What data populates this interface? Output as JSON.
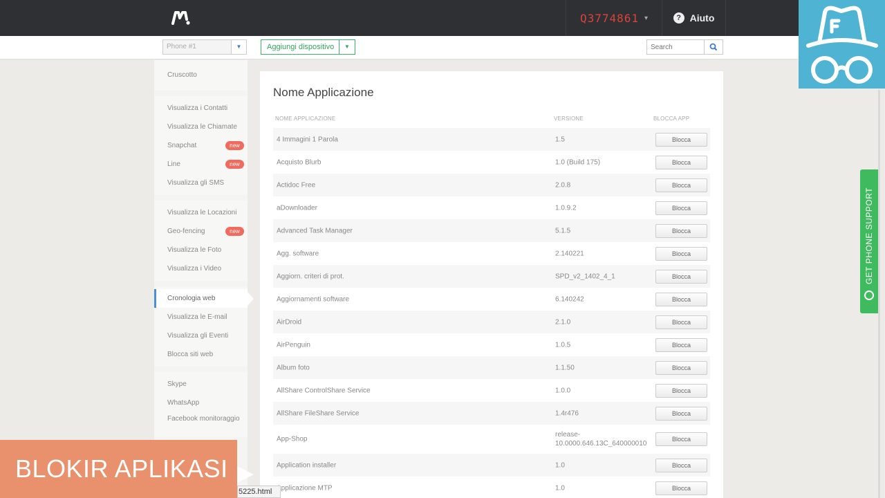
{
  "header": {
    "logo_icon": "mspy-logo-icon",
    "account_id": "Q3774861",
    "account_caret": "▾",
    "help_label": "Aiuto",
    "help_icon": "question-circle-icon"
  },
  "toolbar": {
    "phone_select_value": "Phone #1",
    "add_device_label": "Aggiungi dispositivo",
    "search_placeholder": "Search",
    "search_icon": "magnifier-icon"
  },
  "sidebar": {
    "groups": [
      [
        {
          "label": "Cruscotto"
        }
      ],
      [
        {
          "label": "Visualizza i Contatti"
        },
        {
          "label": "Visualizza le Chiamate"
        },
        {
          "label": "Snapchat",
          "badge": "new"
        },
        {
          "label": "Line",
          "badge": "new"
        },
        {
          "label": "Visualizza gli SMS"
        }
      ],
      [
        {
          "label": "Visualizza le Locazioni"
        },
        {
          "label": "Geo-fencing",
          "badge": "new"
        },
        {
          "label": "Visualizza le Foto"
        },
        {
          "label": "Visualizza i Video"
        }
      ],
      [
        {
          "label": "Cronologia web",
          "active": true
        },
        {
          "label": "Visualizza le E-mail"
        },
        {
          "label": "Visualizza gli Eventi"
        },
        {
          "label": "Blocca siti web"
        }
      ],
      [
        {
          "label": "Skype"
        },
        {
          "label": "WhatsApp"
        },
        {
          "label": "Facebook monitoraggio"
        }
      ]
    ]
  },
  "main": {
    "title": "Nome Applicazione",
    "columns": [
      "NOME APPLICAZIONE",
      "VERSIONE",
      "BLOCCA APP"
    ],
    "block_label": "Blocca",
    "rows": [
      {
        "name": "4 Immagini 1 Parola",
        "version": "1.5"
      },
      {
        "name": "Acquisto Blurb",
        "version": "1.0 (Build 175)"
      },
      {
        "name": "Actidoc Free",
        "version": "2.0.8"
      },
      {
        "name": "aDownloader",
        "version": "1.0.9.2"
      },
      {
        "name": "Advanced Task Manager",
        "version": "5.1.5"
      },
      {
        "name": "Agg. software",
        "version": "2.140221"
      },
      {
        "name": "Aggiorn. criteri di prot.",
        "version": "SPD_v2_1402_4_1"
      },
      {
        "name": "Aggiornamenti software",
        "version": "6.140242"
      },
      {
        "name": "AirDroid",
        "version": "2.1.0"
      },
      {
        "name": "AirPenguin",
        "version": "1.0.5"
      },
      {
        "name": "Album foto",
        "version": "1.1.50"
      },
      {
        "name": "AllShare ControlShare Service",
        "version": "1.0.0"
      },
      {
        "name": "AllShare FileShare Service",
        "version": "1.4r476"
      },
      {
        "name": "App-Shop",
        "version": "release-10.0000.646.13C_640000010",
        "tall": true
      },
      {
        "name": "Application installer",
        "version": "1.0"
      },
      {
        "name": "Applicazione MTP",
        "version": "1.0"
      }
    ]
  },
  "support_tab": {
    "label": "GET PHONE SUPPORT",
    "icon": "headset-icon"
  },
  "overlay": {
    "badge_icon": "spy-hat-glasses-icon",
    "caption": "BLOKIR APLIKASI",
    "status_url": "5225.html"
  },
  "colors": {
    "topbar": "#2f3033",
    "account_id": "#d9433c",
    "accent_green": "#3fba5e",
    "badge_red": "#f16a5d",
    "spy_badge": "#4fb3d3",
    "caption_bg": "#e9906d"
  }
}
